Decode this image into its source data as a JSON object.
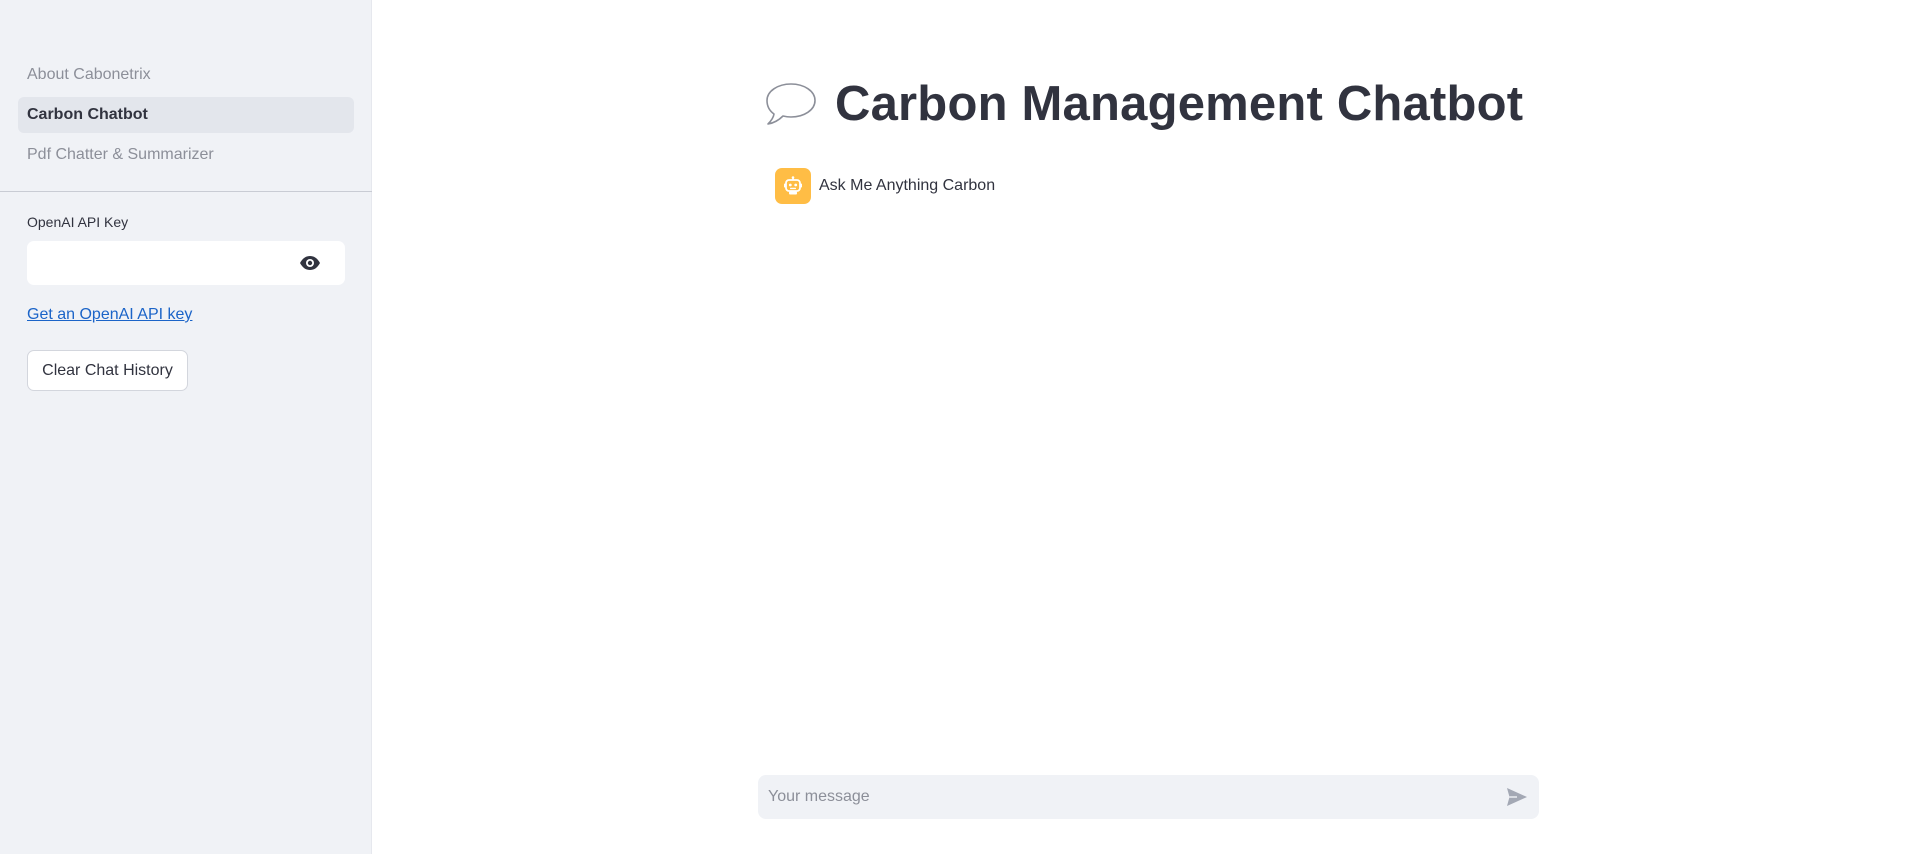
{
  "sidebar": {
    "nav_items": [
      {
        "label": "About Cabonetrix",
        "active": false
      },
      {
        "label": "Carbon Chatbot",
        "active": true
      },
      {
        "label": "Pdf Chatter & Summarizer",
        "active": false
      }
    ],
    "api_key_label": "OpenAI API Key",
    "api_key_value": "",
    "api_key_link_text": "Get an OpenAI API key",
    "clear_button_label": "Clear Chat History",
    "eye_icon": "eye-icon"
  },
  "main": {
    "title_icon": "speech-balloon-icon",
    "title": "Carbon Management Chatbot",
    "messages": [
      {
        "role": "assistant",
        "avatar_icon": "robot-icon",
        "text": "Ask Me Anything Carbon"
      }
    ],
    "chat_input": {
      "placeholder": "Your message",
      "value": "",
      "send_icon": "send-icon"
    }
  },
  "colors": {
    "sidebar_bg": "#f0f2f6",
    "text": "#31333f",
    "muted_text": "#8c8f99",
    "link": "#1b64c8",
    "assistant_avatar_bg": "#ffbd45"
  }
}
